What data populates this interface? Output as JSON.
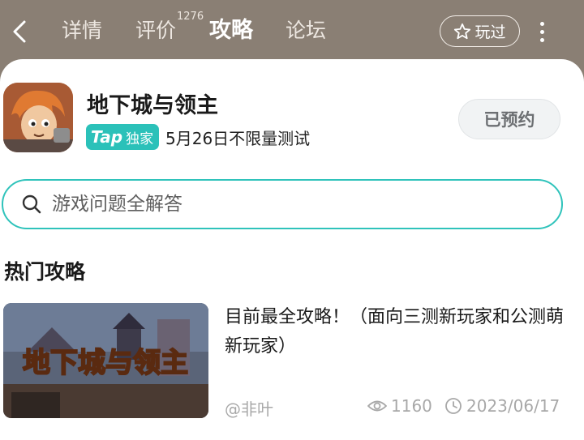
{
  "nav": {
    "tabs": [
      {
        "label": "详情"
      },
      {
        "label": "评价",
        "badge": "1276"
      },
      {
        "label": "攻略",
        "active": true
      },
      {
        "label": "论坛"
      }
    ],
    "played_label": "玩过"
  },
  "game": {
    "title": "地下城与领主",
    "badge_tap": "Tap",
    "badge_exclusive": "独家",
    "test_info": "5月26日不限量测试",
    "reserve_label": "已预约"
  },
  "search": {
    "placeholder": "游戏问题全解答"
  },
  "hot": {
    "section_title": "热门攻略",
    "guide": {
      "thumb_text": "地下城与领主",
      "title": "目前最全攻略！（面向三测新玩家和公测萌新玩家）",
      "author": "@非叶",
      "views": "1160",
      "date": "2023/06/17"
    }
  },
  "colors": {
    "header_bg": "#8a7f74",
    "accent": "#2bc1b9",
    "meta_text": "#a8a8a8"
  }
}
